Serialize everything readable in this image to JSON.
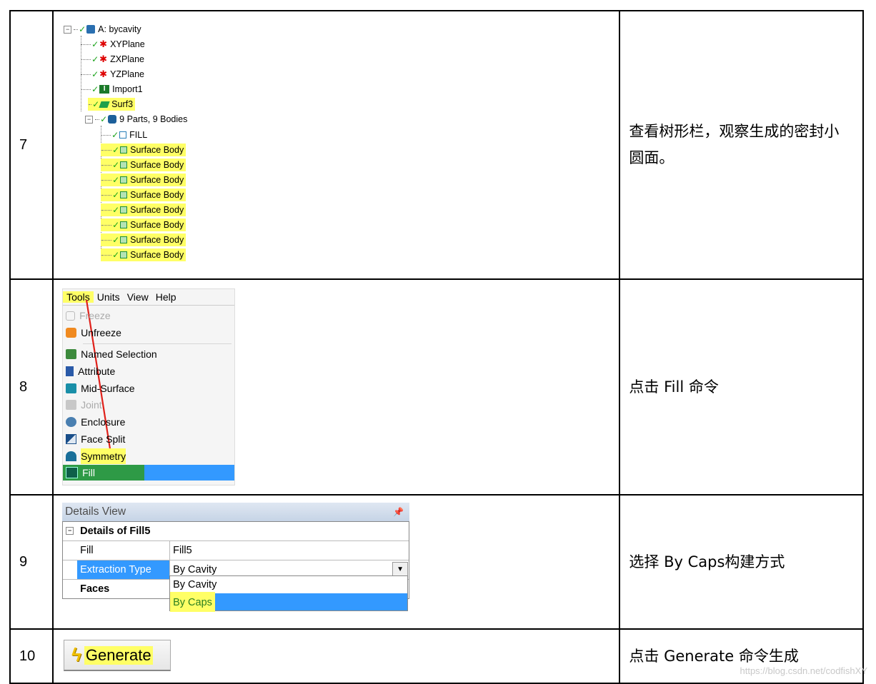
{
  "rows": [
    {
      "number": "7",
      "description": "查看树形栏，观察生成的密封小圆面。"
    },
    {
      "number": "8",
      "description": "点击 Fill 命令"
    },
    {
      "number": "9",
      "description": "选择 By  Caps构建方式"
    },
    {
      "number": "10",
      "description": "点击 Generate 命令生成"
    }
  ],
  "tree": {
    "root": "A: bycavity",
    "planes": [
      "XYPlane",
      "ZXPlane",
      "YZPlane"
    ],
    "import": "Import1",
    "surf": "Surf3",
    "parts": "9 Parts, 9 Bodies",
    "fill": "FILL",
    "surface_body": "Surface Body"
  },
  "menu": {
    "bar": [
      "Tools",
      "Units",
      "View",
      "Help"
    ],
    "items": {
      "freeze": "Freeze",
      "unfreeze": "Unfreeze",
      "named_selection": "Named Selection",
      "attribute": "Attribute",
      "mid_surface": "Mid-Surface",
      "joint": "Joint",
      "enclosure": "Enclosure",
      "face_split": "Face Split",
      "symmetry": "Symmetry",
      "fill": "Fill"
    }
  },
  "details": {
    "title": "Details View",
    "pin": "ᵖ",
    "header": "Details of Fill5",
    "rows": [
      {
        "key": "Fill",
        "value": "Fill5"
      },
      {
        "key": "Extraction Type",
        "value": "By Cavity"
      },
      {
        "key": "Faces",
        "value": ""
      }
    ],
    "options": [
      "By Cavity",
      "By Caps"
    ]
  },
  "generate": {
    "label": "Generate"
  },
  "watermark": "https://blog.csdn.net/codfishXY",
  "colors": {
    "highlight": "#ffff66",
    "selection": "#3399ff",
    "fill_green": "#2e9a46",
    "arrow": "#e0201a"
  },
  "icons": {
    "check": "check-icon",
    "bolt": "lightning-icon",
    "dropdown": "chevron-down-icon"
  }
}
